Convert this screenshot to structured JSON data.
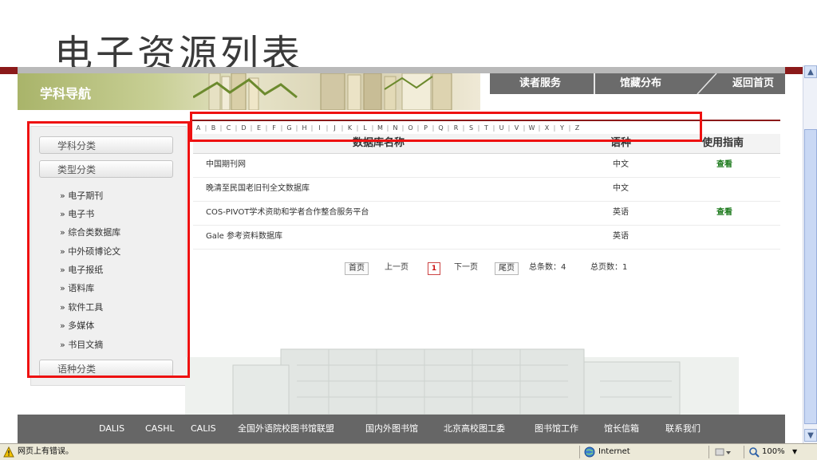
{
  "page": {
    "heading": "电子资源列表"
  },
  "header": {
    "title": "学科导航",
    "nav": [
      "读者服务",
      "馆藏分布",
      "返回首页"
    ]
  },
  "sidebar": {
    "buttons": [
      "学科分类",
      "类型分类",
      "语种分类"
    ],
    "links": [
      "电子期刊",
      "电子书",
      "综合类数据库",
      "中外硕博论文",
      "电子报纸",
      "语料库",
      "软件工具",
      "多媒体",
      "书目文摘"
    ],
    "bullet": "»"
  },
  "alphabet": [
    "A",
    "B",
    "C",
    "D",
    "E",
    "F",
    "G",
    "H",
    "I",
    "J",
    "K",
    "L",
    "M",
    "N",
    "O",
    "P",
    "Q",
    "R",
    "S",
    "T",
    "U",
    "V",
    "W",
    "X",
    "Y",
    "Z"
  ],
  "table": {
    "headers": {
      "name": "数据库名称",
      "lang": "语种",
      "guide": "使用指南"
    },
    "rows": [
      {
        "name": "中国期刊网",
        "lang": "中文",
        "guide": "查看"
      },
      {
        "name": "晚清至民国老旧刊全文数据库",
        "lang": "中文",
        "guide": ""
      },
      {
        "name": "COS-PIVOT学术资助和学者合作整合服务平台",
        "lang": "英语",
        "guide": "查看"
      },
      {
        "name": "Gale 参考资料数据库",
        "lang": "英语",
        "guide": ""
      }
    ]
  },
  "pager": {
    "first": "首页",
    "prev": "上一页",
    "current": "1",
    "next": "下一页",
    "last": "尾页",
    "total_label": "总条数：4",
    "pages_label": "总页数：1"
  },
  "footer": {
    "links": [
      "DALIS",
      "CASHL",
      "CALIS",
      "全国外语院校图书馆联盟",
      "国内外图书馆",
      "北京高校图工委",
      "图书馆工作",
      "馆长信箱",
      "联系我们"
    ]
  },
  "statusbar": {
    "message": "网页上有错误。",
    "zone": "Internet",
    "zoom": "100%"
  },
  "colors": {
    "highlight": "#e11111",
    "nav_bg": "#6b6b6b",
    "footer_bg": "#666666",
    "accent_rule": "#8b1a1a",
    "link_green": "#1d7a1d"
  },
  "icons": {
    "warning": "warning-icon",
    "globe": "globe-icon",
    "zoom": "magnifier-icon"
  }
}
